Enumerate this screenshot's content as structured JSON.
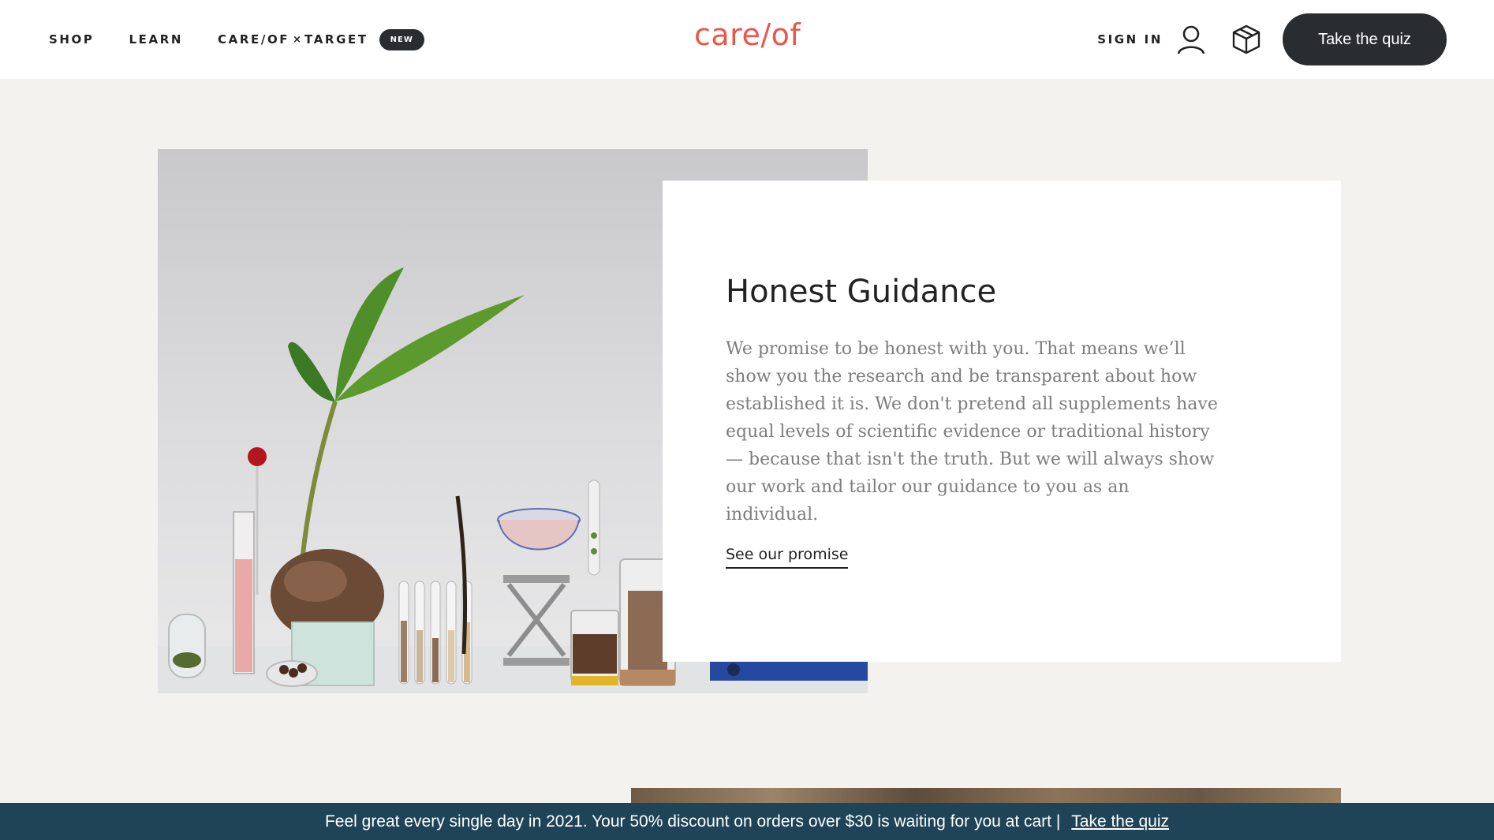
{
  "header": {
    "nav": {
      "shop": "SHOP",
      "learn": "LEARN",
      "careof_target_left": "CARE/OF",
      "careof_target_x": "×",
      "careof_target_right": "TARGET",
      "new_badge": "NEW"
    },
    "logo": "care/of",
    "sign_in": "SIGN IN",
    "account_icon": "account-icon",
    "box_icon": "box-icon",
    "quiz_button": "Take the quiz"
  },
  "colors": {
    "brand": "#e8574a",
    "dark": "#2a2d30",
    "background": "#f4f2ee",
    "banner": "#1f4357"
  },
  "card": {
    "title": "Honest Guidance",
    "body": "We promise to be honest with you. That means we’ll show you the research and be transparent about how established it is. We don't pretend all supplements have equal levels of scientific evidence or traditional history — because that isn't the truth. But we will always show our work and tailor our guidance to you as an individual.",
    "link": "See our promise"
  },
  "promo": {
    "text": "Feel great every single day in 2021. Your 50% discount on orders over $30 is waiting for you at cart |",
    "link": "Take the quiz"
  }
}
